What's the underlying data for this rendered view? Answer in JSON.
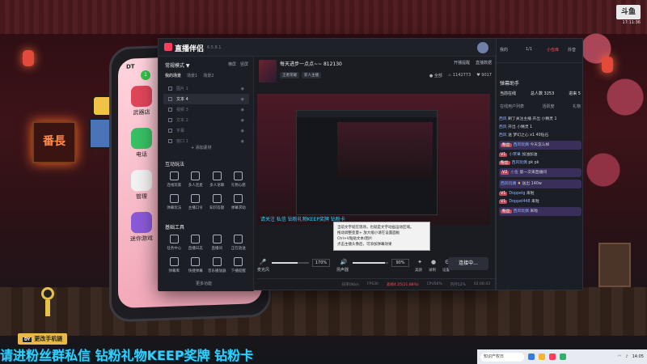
{
  "background": {
    "sign_text": "番長",
    "watermark": "斗鱼",
    "clock": "17:11:36"
  },
  "phone": {
    "status": "DT",
    "badge": "1",
    "apps": [
      {
        "label": "武器店",
        "color": "#e0465a"
      },
      {
        "label": "电话",
        "color": "#37c064"
      },
      {
        "label": "管理",
        "color": "#f2f2f2"
      },
      {
        "label": "迷你游戏",
        "color": "#8a5ad8"
      }
    ]
  },
  "window": {
    "app_title": "直播伴侣",
    "version": "6.5.8.1",
    "stream_title": "每天进步一点点~~ 812130",
    "titlebar_icons": [
      "□",
      "☺",
      "♫",
      "—",
      "▢",
      "✕"
    ]
  },
  "left_panel": {
    "mode": "常规模式 ▼",
    "head_right": [
      "横屏",
      "竖屏"
    ],
    "tabs": [
      {
        "label": "我的场景",
        "active": true
      },
      {
        "label": "场景1",
        "active": false
      },
      {
        "label": "场景2",
        "active": false
      }
    ],
    "scenes": [
      {
        "label": "图片 1",
        "active": false
      },
      {
        "label": "文本 4",
        "active": true
      },
      {
        "label": "视频 3",
        "active": false
      },
      {
        "label": "文本 2",
        "active": false
      },
      {
        "label": "字幕",
        "active": false
      },
      {
        "label": "窗口 1",
        "active": false
      }
    ],
    "add_source": "+ 添加素材",
    "interactive_title": "互动玩法",
    "interactive_tools": [
      "连线玩家",
      "多人连麦",
      "多人语聊",
      "礼物心愿",
      "弹幕玩法",
      "主播口令",
      "知识答题",
      "弹幕求助"
    ],
    "basic_title": "基础工具",
    "basic_tools": [
      "任务中心",
      "直播日志",
      "直播间",
      "正在放送",
      "弹幕库",
      "快捷弹幕",
      "音乐播放器",
      "下播提醒"
    ],
    "more": "更多功能"
  },
  "preview": {
    "tags": [
      "王者荣耀",
      "新人主播"
    ],
    "right_top": [
      "开播提醒",
      "直播数据"
    ],
    "right_bottom": [
      {
        "icon": "●",
        "label": "全部",
        "badge": ""
      },
      {
        "icon": "♨",
        "label": "",
        "badge": "1142773"
      },
      {
        "icon": "♥",
        "label": "",
        "badge": "9017"
      }
    ],
    "marquee": "请关注 私信 钻粉礼物KEEP奖牌 钻粉卡",
    "tooltip": [
      "当前文字就在现场，也就是文字动画运动区域。",
      "拖动调整变量+ 放大缩小请在设置面板",
      "Ctrl+V粘贴文本/图片",
      "点击主播头像后，可添加弹幕效果"
    ]
  },
  "controls": {
    "mic_label": "麦克风",
    "mic_value": "170%",
    "mic_level": 0.7,
    "speaker_label": "扬声器",
    "speaker_value": "90%",
    "speaker_level": 0.9,
    "buttons": [
      "美颜",
      "录制",
      "设置"
    ],
    "go_live": "连接中..."
  },
  "status": {
    "bitrate": "码率0kb/s",
    "fps": "FPS30",
    "dropped": "丢帧4.25(21.88%)",
    "cpu": "CPU56%",
    "mem": "内存52%",
    "time": "02:08:43"
  },
  "chat": {
    "top": [
      "我的",
      "1/1",
      "小仓库",
      "抖音"
    ],
    "title": "弹幕助手",
    "stats": [
      "当前在线",
      "总人数 3253",
      "进来 5"
    ],
    "tabs": [
      "在线用户列表",
      "活跃度",
      "礼物"
    ],
    "messages": [
      {
        "user": "西风",
        "text": "刷了关注主播 开出 小精灵 1",
        "tag": "",
        "gift": "",
        "hl": false
      },
      {
        "user": "西风",
        "text": "开出 小精灵 1",
        "tag": "",
        "gift": "",
        "hl": false
      },
      {
        "user": "西风",
        "text": "送 梦幻之心 x1 40钻石",
        "tag": "",
        "gift": "",
        "hl": false
      },
      {
        "user": "西风玩偶",
        "text": "今天怎么样",
        "tag": "粉丝",
        "gift": "",
        "hl": true
      },
      {
        "user": "小苹果",
        "text": "加油加油",
        "tag": "V1",
        "gift": "",
        "hl": false
      },
      {
        "user": "西风玩偶",
        "text": "pk pk",
        "tag": "粉丝",
        "gift": "",
        "hl": false
      },
      {
        "user": "小鱼",
        "text": "第一次来直播间",
        "tag": "V2",
        "gift": "",
        "hl": true
      },
      {
        "user": "西风玩偶",
        "text": "送出 140w",
        "tag": "",
        "gift": "♦",
        "hl": true
      },
      {
        "user": "Doppelg",
        "text": "来啦",
        "tag": "V1",
        "gift": "",
        "hl": false
      },
      {
        "user": "Doppel448",
        "text": "来啦",
        "tag": "V1",
        "gift": "",
        "hl": false
      },
      {
        "user": "西风玩偶",
        "text": "来啦",
        "tag": "粉丝",
        "gift": "",
        "hl": true
      }
    ]
  },
  "overlay": {
    "phone_change": "更改手机链",
    "phone_change_tag": "DY",
    "bottom_marquee": "请进粉丝群私信 钻粉礼物KEEP奖牌 钻粉卡"
  },
  "taskbar": {
    "search": "知识产权日",
    "time": "14:05"
  }
}
